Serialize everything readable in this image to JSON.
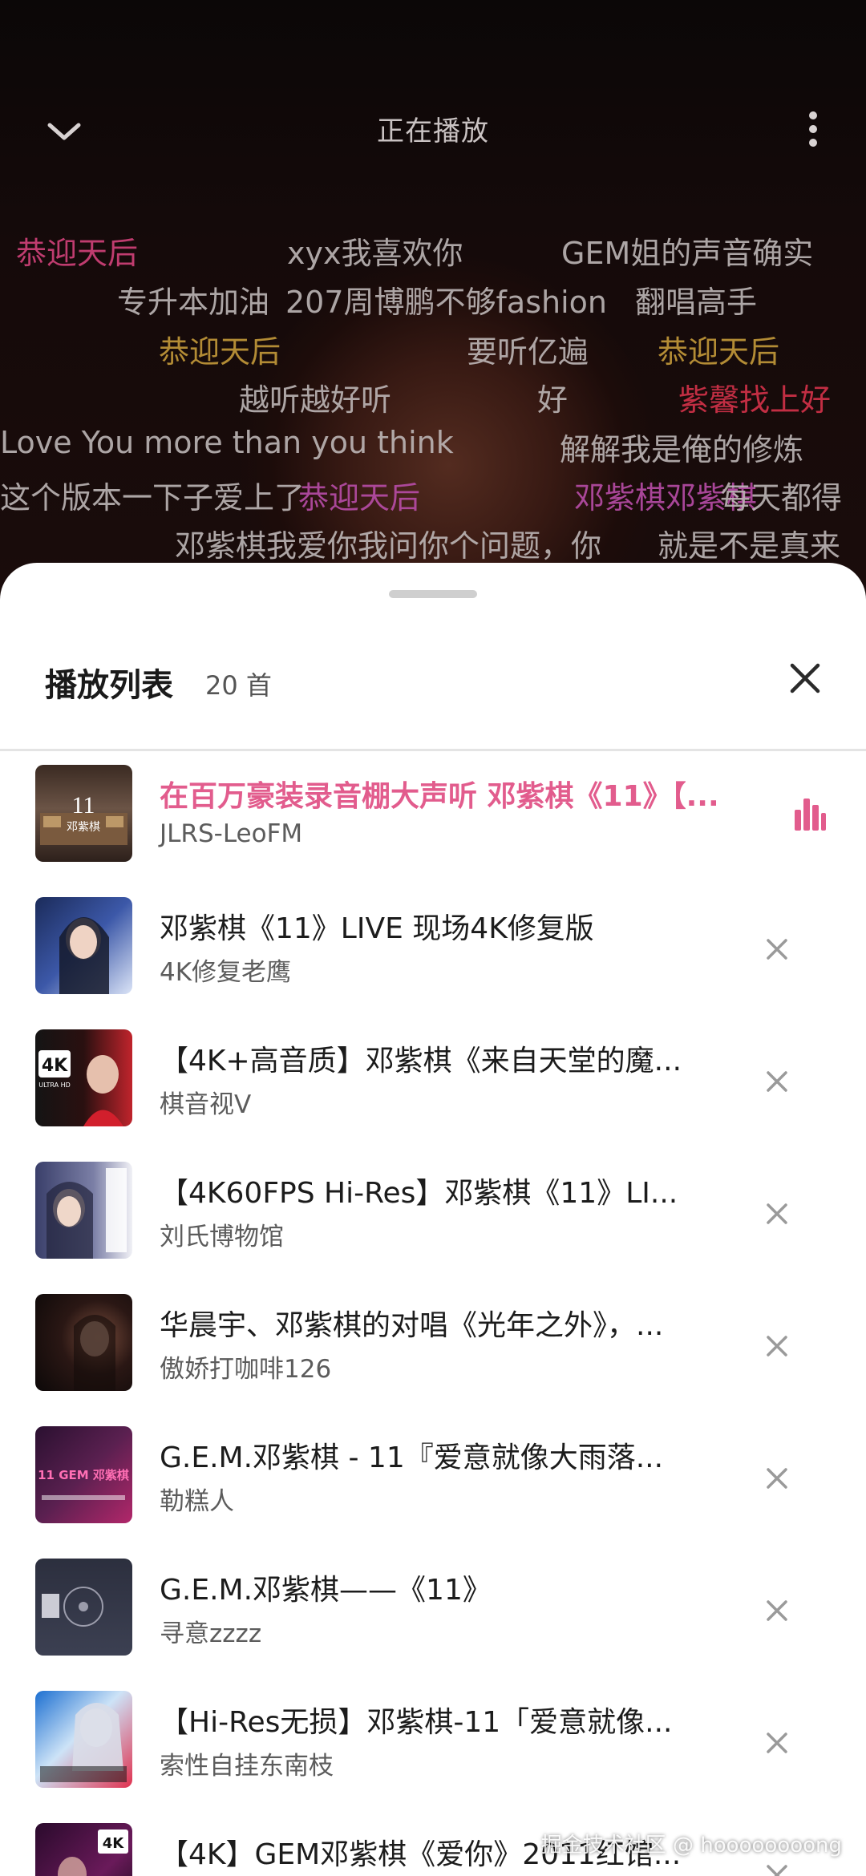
{
  "header": {
    "title": "正在播放"
  },
  "danmaku": [
    {
      "text": "恭迎天后",
      "color": "pink"
    },
    {
      "text": "xyx我喜欢你",
      "color": "white"
    },
    {
      "text": "GEM姐的声音确实",
      "color": "white"
    },
    {
      "text": "专升本加油",
      "color": "white"
    },
    {
      "text": "207周博鹏不够fashion",
      "color": "white"
    },
    {
      "text": "翻唱高手",
      "color": "white"
    },
    {
      "text": "恭迎天后",
      "color": "gold"
    },
    {
      "text": "要听亿遍",
      "color": "white"
    },
    {
      "text": "恭迎天后",
      "color": "gold"
    },
    {
      "text": "越听越好听",
      "color": "white"
    },
    {
      "text": "好",
      "color": "white"
    },
    {
      "text": "紫馨找上好",
      "color": "red"
    },
    {
      "text": "Love You more than you think",
      "color": "white"
    },
    {
      "text": "解解我是俺的修炼",
      "color": "white"
    },
    {
      "text": "这个版本一下子爱上了",
      "color": "white"
    },
    {
      "text": "恭迎天后",
      "color": "purple"
    },
    {
      "text": "邓紫棋邓紫棋",
      "color": "purple"
    },
    {
      "text": "每天都得",
      "color": "white"
    },
    {
      "text": "邓紫棋我爱你",
      "color": "white"
    },
    {
      "text": "我问你个问题，你",
      "color": "white"
    },
    {
      "text": "就是不是真来",
      "color": "white"
    }
  ],
  "playlist": {
    "title": "播放列表",
    "count": "20 首",
    "items": [
      {
        "title": "在百万豪装录音棚大声听 邓紫棋《11》【...",
        "artist": "JLRS-LeoFM",
        "active": true
      },
      {
        "title": "邓紫棋《11》LIVE 现场4K修复版",
        "artist": "4K修复老鹰",
        "active": false
      },
      {
        "title": "【4K+高音质】邓紫棋《来自天堂的魔...",
        "artist": "棋音视V",
        "active": false
      },
      {
        "title": "【4K60FPS Hi-Res】邓紫棋《11》LI...",
        "artist": "刘氏博物馆",
        "active": false
      },
      {
        "title": "华晨宇、邓紫棋的对唱《光年之外》，...",
        "artist": "傲娇打咖啡126",
        "active": false
      },
      {
        "title": "G.E.M.邓紫棋 - 11『爱意就像大雨落...",
        "artist": "勒糕人",
        "active": false
      },
      {
        "title": "G.E.M.邓紫棋——《11》",
        "artist": "寻意zzzz",
        "active": false
      },
      {
        "title": "【Hi-Res无损】邓紫棋-11「爱意就像...",
        "artist": "索性自挂东南枝",
        "active": false
      },
      {
        "title": "【4K】GEM邓紫棋《爱你》2011红馆...",
        "artist": "",
        "active": false
      }
    ]
  },
  "thumb_labels": {
    "t1_num": "11",
    "t1_name": "邓紫棋",
    "t3_badge": "4K",
    "t3_sub": "ULTRA HD",
    "t6_text": "11 GEM 邓紫棋",
    "t9_badge": "4K"
  },
  "watermark": "掘金技术社区 @ hoooooooong",
  "colors": {
    "accent": "#e25c8d",
    "sheet_bg": "#ffffff",
    "player_bg": "#0b0606"
  }
}
